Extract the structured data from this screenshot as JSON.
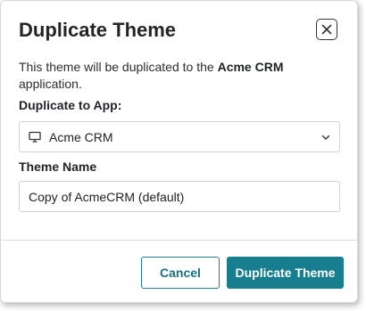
{
  "dialog": {
    "title": "Duplicate Theme",
    "description_prefix": "This theme will be duplicated to the ",
    "description_app": "Acme CRM",
    "description_suffix": " application.",
    "close_icon": "close-icon"
  },
  "form": {
    "app_label": "Duplicate to App:",
    "app_selected": "Acme CRM",
    "app_icon": "monitor-icon",
    "theme_name_label": "Theme Name",
    "theme_name_value": "Copy of AcmeCRM (default)"
  },
  "footer": {
    "cancel_label": "Cancel",
    "confirm_label": "Duplicate Theme"
  },
  "colors": {
    "accent": "#167e8f",
    "border": "#cfd3d7"
  }
}
